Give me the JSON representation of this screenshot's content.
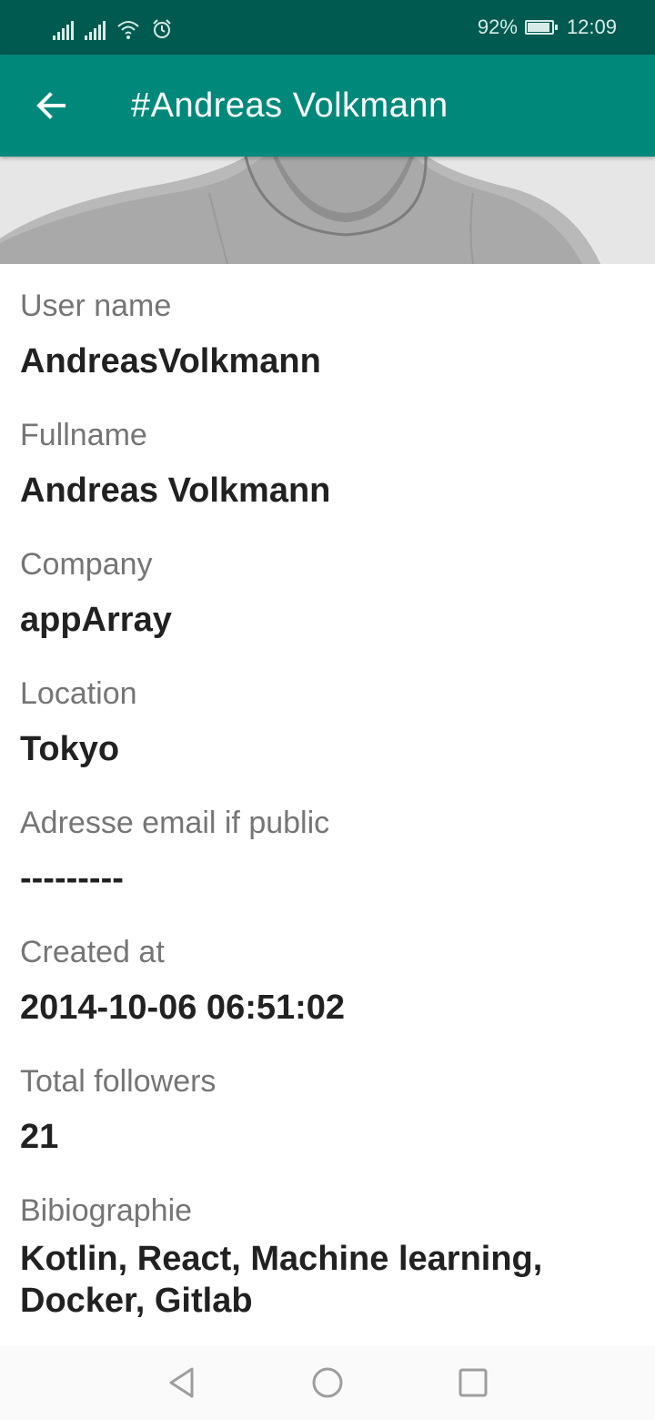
{
  "status_bar": {
    "battery_percent": "92%",
    "battery_level": 0.92,
    "time": "12:09",
    "icons": [
      "signal-icon",
      "signal-icon",
      "wifi-icon",
      "alarm-icon",
      "battery-charging-icon"
    ]
  },
  "app_bar": {
    "back_icon": "arrow-back-icon",
    "title": "#Andreas Volkmann",
    "color": "#00897b"
  },
  "profile": {
    "header_image": "profile-photo",
    "fields": [
      {
        "label": "User name",
        "value": "AndreasVolkmann"
      },
      {
        "label": "Fullname",
        "value": "Andreas Volkmann"
      },
      {
        "label": "Company",
        "value": "appArray"
      },
      {
        "label": "Location",
        "value": "Tokyo"
      },
      {
        "label": "Adresse email if public",
        "value": "---------"
      },
      {
        "label": "Created at",
        "value": "2014-10-06 06:51:02"
      },
      {
        "label": "Total followers",
        "value": "21"
      },
      {
        "label": "Bibiographie",
        "value": "Kotlin, React, Machine learning, Docker, Gitlab"
      }
    ]
  },
  "nav_bar": {
    "buttons": [
      "back-triangle-icon",
      "home-circle-icon",
      "recents-square-icon"
    ]
  }
}
